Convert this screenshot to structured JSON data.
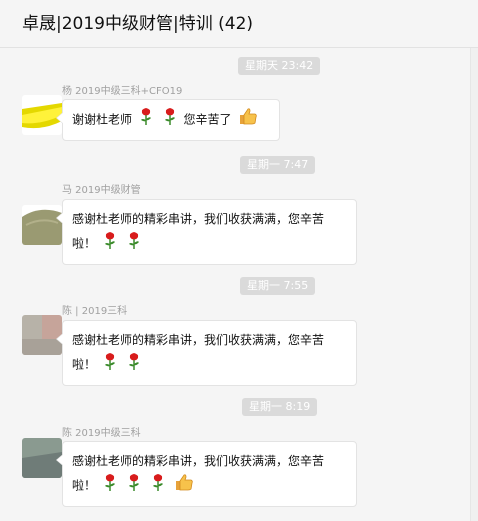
{
  "header": {
    "title": "卓晟|2019中级财管|特训 (42)"
  },
  "messages": [
    {
      "time": "星期天 23:42",
      "sender": "杨 2019中级三科+CFO19",
      "text": "谢谢杜老师",
      "text2": "您辛苦了"
    },
    {
      "time": "星期一 7:47",
      "sender": "马 2019中级财管",
      "text": "感谢杜老师的精彩串讲，我们收获满满，您辛苦",
      "text2": "啦！"
    },
    {
      "time": "星期一 7:55",
      "sender": "陈 | 2019三科",
      "text": "感谢杜老师的精彩串讲，我们收获满满，您辛苦",
      "text2": "啦！"
    },
    {
      "time": "星期一 8:19",
      "sender": "陈 2019中级三科",
      "text": "感谢杜老师的精彩串讲，我们收获满满，您辛苦",
      "text2": "啦！"
    }
  ],
  "emoji": {
    "rose": "rose-icon",
    "thumbs": "thumbs-up-icon"
  },
  "colors": {
    "background": "#f5f5f5",
    "bubble": "#ffffff",
    "timestamp_bg": "#dadada"
  }
}
